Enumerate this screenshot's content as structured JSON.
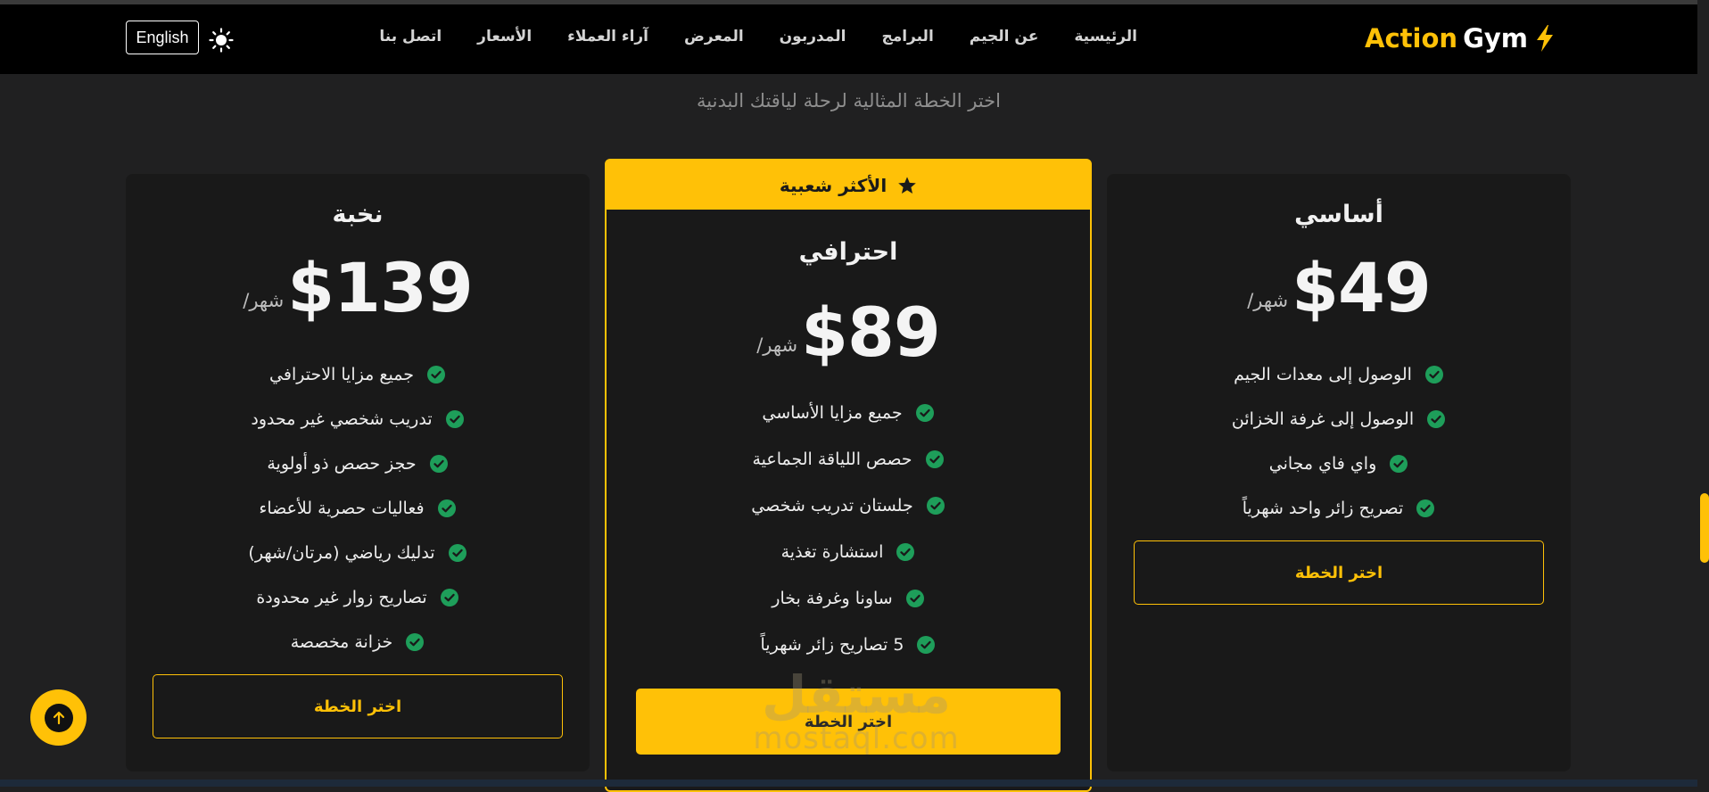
{
  "navbar": {
    "brand_part1": "Action",
    "brand_part2": "Gym",
    "brand_icon": "bolt-icon",
    "links": [
      "الرئيسية",
      "عن الجيم",
      "البرامج",
      "المدربون",
      "المعرض",
      "آراء العملاء",
      "الأسعار",
      "اتصل بنا"
    ],
    "language_button": "English",
    "theme_icon": "sun-icon"
  },
  "subtitle": "اختر الخطة المثالية لرحلة لياقتك البدنية",
  "plans": {
    "basic": {
      "name": "أساسي",
      "price": "$49",
      "period": "/شهر",
      "features": [
        "الوصول إلى معدات الجيم",
        "الوصول إلى غرفة الخزائن",
        "واي فاي مجاني",
        "تصريح زائر واحد شهرياً"
      ],
      "button": "اختر الخطة"
    },
    "pro": {
      "badge": "الأكثر شعبية",
      "name": "احترافي",
      "price": "$89",
      "period": "/شهر",
      "features": [
        "جميع مزايا الأساسي",
        "حصص اللياقة الجماعية",
        "جلستان تدريب شخصي",
        "استشارة تغذية",
        "ساونا وغرفة بخار",
        "5 تصاريح زائر شهرياً"
      ],
      "button": "اختر الخطة"
    },
    "elite": {
      "name": "نخبة",
      "price": "$139",
      "period": "/شهر",
      "features": [
        "جميع مزايا الاحترافي",
        "تدريب شخصي غير محدود",
        "حجز حصص ذو أولوية",
        "فعاليات حصرية للأعضاء",
        "تدليك رياضي (مرتان/شهر)",
        "تصاريح زوار غير محدودة",
        "خزانة مخصصة"
      ],
      "button": "اختر الخطة"
    }
  },
  "watermark": {
    "line1": "مستقل",
    "line2": "mostaql.com"
  },
  "colors": {
    "accent": "#ffc107",
    "check": "#1e9e5a",
    "background": "#202021",
    "card": "#191919",
    "navbar": "#000000"
  }
}
